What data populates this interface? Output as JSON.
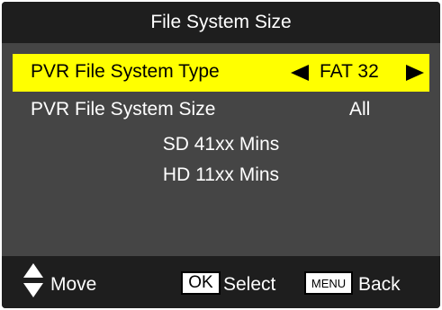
{
  "header": {
    "title": "File System Size"
  },
  "rows": [
    {
      "label": "PVR File System Type",
      "value": "FAT 32",
      "selected": true
    },
    {
      "label": "PVR File System Size",
      "value": "All",
      "selected": false
    }
  ],
  "info": {
    "sd": "SD 41xx Mins",
    "hd": "HD 11xx Mins"
  },
  "footer": {
    "move_label": "Move",
    "ok_key": "OK",
    "select_label": "Select",
    "menu_key": "MENU",
    "back_label": "Back"
  },
  "colors": {
    "highlight": "#ffff00",
    "panel": "#454545",
    "bar": "#1e1e1e"
  },
  "icons": {
    "left": "triangle-left-icon",
    "right": "triangle-right-icon",
    "up": "triangle-up-icon",
    "down": "triangle-down-icon"
  }
}
